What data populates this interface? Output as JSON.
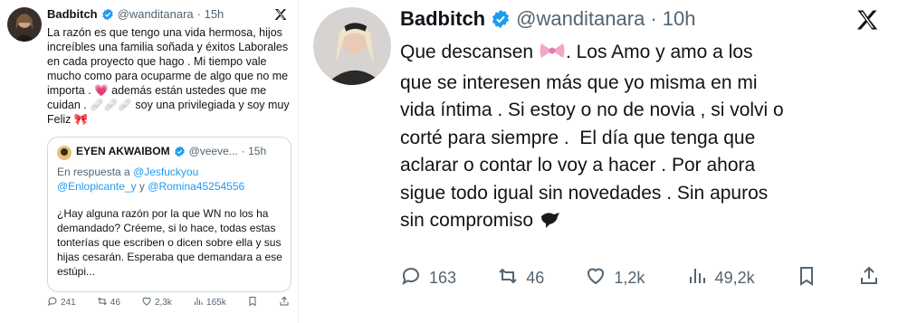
{
  "left_tweet": {
    "author_name": "Badbitch",
    "handle": "@wanditanara",
    "time": "· 15h",
    "text": "La razón es que tengo una vida hermosa, hijos increíbles una familia soñada y éxitos Laborales en cada proyecto que hago . Mi tiempo vale mucho como para ocuparme de algo que no me importa . 💗 además están ustedes que me cuidan . 🩹🩹🩹 soy una privilegiada y soy muy Feliz 🎀",
    "quote": {
      "author_name": "EYEN AKWAIBOM",
      "handle": "@veeve...",
      "time": "· 15h",
      "reply_prefix": "En respuesta a",
      "mention_1": "@Jesfuckyou",
      "mention_2": "@Enlopicante_y",
      "and_word": "y",
      "mention_3": "@Romina45254556",
      "text": "¿Hay alguna razón por la que WN no los ha demandado? Créeme, si lo hace, todas estas tonterías que escriben o dicen sobre ella y sus hijas cesarán. Esperaba que demandara a ese estúpi..."
    },
    "actions": {
      "replies": "241",
      "reposts": "46",
      "likes": "2,3k",
      "views": "165k"
    }
  },
  "right_tweet": {
    "author_name": "Badbitch",
    "handle": "@wanditanara",
    "time": "· 10h",
    "text_before_emoji": "Que descansen ",
    "text_after_emoji": ". Los Amo y amo a los\nque se interesen más que yo misma en mi\nvida íntima . Si estoy o no de novia , si volvi o\ncorté para siempre .  El día que tenga que\naclarar o contar lo voy a hacer . Por ahora\nsigue todo igual sin novedades . Sin apuros\nsin compromiso ",
    "actions": {
      "replies": "163",
      "reposts": "46",
      "likes": "1,2k",
      "views": "49,2k"
    }
  },
  "colors": {
    "verified": "#1d9bf0",
    "text": "#0f1419",
    "muted": "#536471",
    "link": "#1d9bf0",
    "border": "#cfd9de"
  },
  "icons": [
    "x-logo-icon",
    "verified-badge-icon",
    "reply-icon",
    "repost-icon",
    "like-icon",
    "views-icon",
    "bookmark-icon",
    "share-icon",
    "ribbon-emoji",
    "bird-emoji",
    "heart-emoji",
    "bandage-emoji"
  ]
}
